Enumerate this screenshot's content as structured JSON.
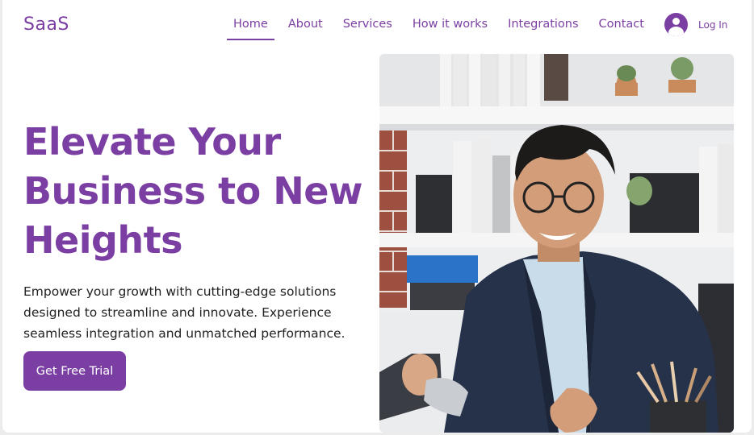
{
  "logo": "SaaS",
  "nav": {
    "items": [
      "Home",
      "About",
      "Services",
      "How it works",
      "Integrations",
      "Contact"
    ],
    "active": "Home"
  },
  "login": {
    "label": "Log In"
  },
  "hero": {
    "title": "Elevate Your Business to New Heights",
    "description": "Empower your growth with cutting-edge solutions designed to streamline and innovate. Experience seamless integration and unmatched performance.",
    "cta": "Get Free Trial"
  },
  "colors": {
    "brand": "#7b3fa3",
    "text": "#222222",
    "background": "#ffffff"
  },
  "icons": [
    "user-avatar-icon"
  ]
}
